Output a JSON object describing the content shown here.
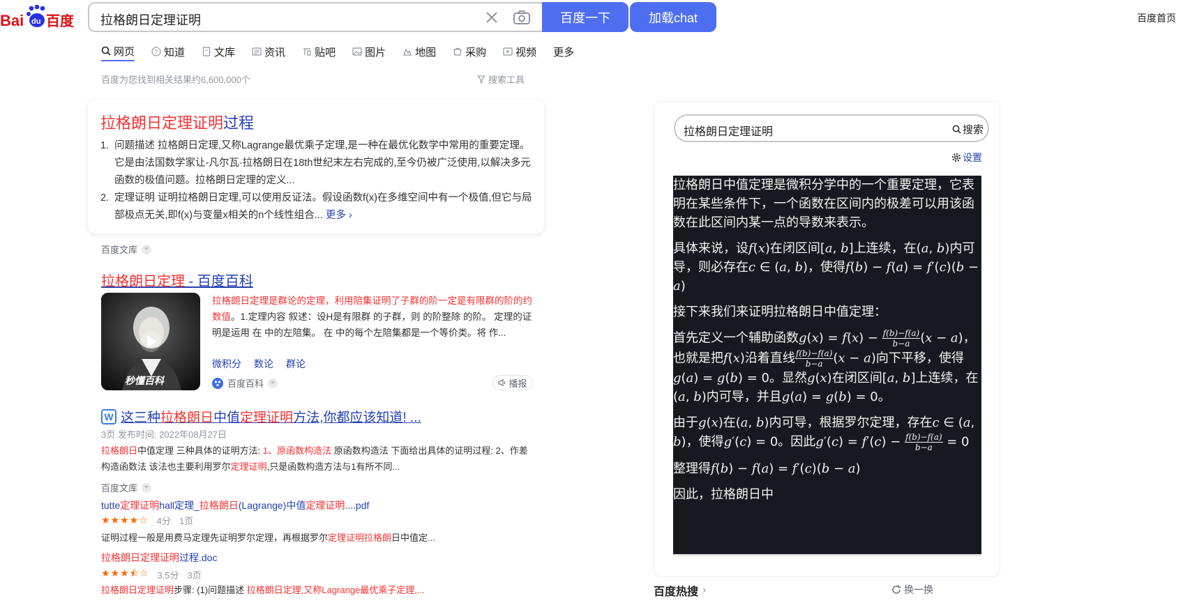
{
  "header": {
    "logo_text_left": "Bai",
    "logo_text_du": "du",
    "logo_text_right": "百度",
    "query": "拉格朗日定理证明",
    "search_button": "百度一下",
    "chat_button": "加载chat",
    "home_link": "百度首页"
  },
  "tabs": [
    {
      "label": "网页",
      "icon": "search-icon"
    },
    {
      "label": "知道",
      "icon": "question-icon"
    },
    {
      "label": "文库",
      "icon": "document-icon"
    },
    {
      "label": "资讯",
      "icon": "news-icon"
    },
    {
      "label": "贴吧",
      "icon": "tieba-icon"
    },
    {
      "label": "图片",
      "icon": "image-icon"
    },
    {
      "label": "地图",
      "icon": "map-icon"
    },
    {
      "label": "采购",
      "icon": "cart-icon"
    },
    {
      "label": "视频",
      "icon": "video-icon"
    },
    {
      "label": "更多"
    }
  ],
  "result_count": "百度为您找到相关结果约6,600,000个",
  "search_tools": "搜索工具",
  "card1": {
    "title_red": "拉格朗日定理证明",
    "title_rest": "过程",
    "items": [
      {
        "num": "1.",
        "text": "问题描述 拉格朗日定理,又称Lagrange最优乘子定理,是一种在最优化数学中常用的重要定理。它是由法国数学家让-凡尔瓦·拉格朗日在18th世纪末左右完成的,至今仍被广泛使用,以解决多元函数的极值问题。拉格朗日定理的定义..."
      },
      {
        "num": "2.",
        "text": "定理证明 证明拉格朗日定理,可以使用反证法。假设函数f(x)在多维空间中有一个极值,但它与局部极点无关,即f(x)与变量x相关的n个线性组合... ",
        "more": "更多"
      }
    ],
    "source": "百度文库"
  },
  "result2": {
    "title_red": "拉格朗日定理",
    "title_rest": " - 百度百科",
    "thumb_watermark": "秒懂百科",
    "desc_red": "拉格朗日定理是群论的定理，利用陪集证明了子群的阶一定是有限群的阶的约数值",
    "desc_rest": "。1.定理内容 叙述：设H是有限群 的子群，则 的阶整除 的阶。 定理的证明是运用 在 中的左陪集。 在 中的每个左陪集都是一个等价类。将 作...",
    "links": [
      "微积分",
      "数论",
      "群论"
    ],
    "source": "百度百科",
    "report": "播报"
  },
  "result3": {
    "title_pre": "这三种",
    "title_red1": "拉格朗日",
    "title_mid": "中值",
    "title_red2": "定理证明",
    "title_post": "方法,你都应该知道! ...",
    "meta": "3页 发布时间: 2022年08月27日",
    "desc_red1": "拉格朗日",
    "desc_1": "中值定理 三种具体的证明方法: ",
    "desc_red2": "1、原函数构造法",
    "desc_2": " 原函数构造法 下面给出具体的证明过程: 2、作差构造函数法 该法也主要利用罗尔",
    "desc_red3": "定理证明",
    "desc_3": ",只是函数构造方法与1有所不同...",
    "source": "百度文库"
  },
  "doc1": {
    "title_a": "tutte",
    "title_red1": "定理证明",
    "title_b": "hall定理_",
    "title_red2": "拉格朗日",
    "title_c": "(Lagrange)中值",
    "title_red3": "定理证明",
    "title_d": "....pdf",
    "stars": "★★★★☆",
    "score": "4分",
    "pages": "1页",
    "desc_a": "证明过程一般是用费马定理先证明罗尔定理，再根据罗尔",
    "desc_red": "定理证明拉格朗",
    "desc_b": "日中值定..."
  },
  "doc2": {
    "title_red": "拉格朗日定理证明",
    "title_rest": "过程.doc",
    "stars": "★★★⯪☆",
    "score": "3.5分",
    "pages": "3页",
    "desc_red1": "拉格朗日定理证明",
    "desc_a": "步骤: (1)问题描述 ",
    "desc_red2": "拉格朗日定理,又称Lagrange最优乘子定理,..."
  },
  "right_panel": {
    "query": "拉格朗日定理证明",
    "search_label": "搜索",
    "settings_label": "设置",
    "chat": {
      "p1": "拉格朗日中值定理是微积分学中的一个重要定理，它表明在某些条件下，一个函数在区间内的极差可以用该函数在此区间内某一点的导数来表示。",
      "p2a": "具体来说，设",
      "p2b": "在闭区间",
      "p2c": "上连续，在",
      "p2d": "内可导，则必存在",
      "p2e": "，使得",
      "p3": "接下来我们来证明拉格朗日中值定理：",
      "p4a": "首先定义一个辅助函数",
      "p4b": "也就是把",
      "p4c": "沿着直线",
      "p4d": "向下平移，使得",
      "p4e": "。显然",
      "p4f": "在闭区间",
      "p4g": "上连续，在",
      "p4h": "内可导，并且",
      "p5a": "由于",
      "p5b": "在",
      "p5c": "内可导，根据罗尔定理，存在",
      "p5d": "，使得",
      "p5e": "。因此",
      "p6": "整理得",
      "p7": "因此，拉格朗日中"
    }
  },
  "hot": {
    "title": "百度热搜",
    "refresh": "换一换"
  },
  "colors": {
    "brand_blue": "#4e6ef2",
    "link_blue": "#2440b3",
    "highlight_red": "#f73131",
    "logo_red": "#de0f17",
    "chat_bg": "#161a20"
  }
}
